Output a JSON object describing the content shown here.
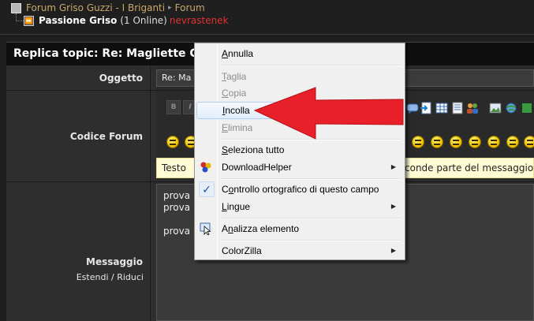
{
  "breadcrumb": {
    "forum_root": "Forum Griso Guzzi - I Briganti",
    "separator": "▸",
    "forum_link": "Forum",
    "forum_name": "Passione Griso",
    "online_count": "(1 Online)",
    "online_user": "nevrastenek"
  },
  "topic": {
    "header": "Replica topic: Re: Magliette G"
  },
  "form": {
    "subject_label": "Oggetto",
    "subject_value": "Re: Ma",
    "code_label": "Codice Forum",
    "toolbar_bold": "B",
    "toolbar_italic": "I",
    "help_text_left": "Testo",
    "help_text_right": "conde parte del messaggio a",
    "message_label": "Messaggio",
    "expand_label": "Estendi",
    "expand_sep": "/",
    "reduce_label": "Riduci",
    "message_lines": [
      "prova",
      "prova",
      "",
      "prova p"
    ]
  },
  "context_menu": {
    "items": [
      {
        "label": "Annulla",
        "accel": "A",
        "rest": "nnulla",
        "disabled": false
      },
      {
        "label": "Taglia",
        "accel": "T",
        "rest": "aglia",
        "disabled": true
      },
      {
        "label": "Copia",
        "accel": "C",
        "rest": "opia",
        "disabled": true
      },
      {
        "label": "Incolla",
        "accel": "I",
        "rest": "ncolla",
        "disabled": false
      },
      {
        "label": "Elimina",
        "accel": "E",
        "rest": "limina",
        "disabled": true
      },
      {
        "label": "Seleziona tutto",
        "accel": "S",
        "rest": "eleziona tutto",
        "disabled": false
      },
      {
        "label": "DownloadHelper",
        "disabled": false
      },
      {
        "label": "Controllo ortografico di questo campo",
        "accel": "o",
        "pre": "C",
        "rest": "ntrollo ortografico di questo campo",
        "disabled": false
      },
      {
        "label": "Lingue",
        "accel": "L",
        "rest": "ingue",
        "disabled": false
      },
      {
        "label": "Analizza elemento",
        "accel": "n",
        "pre": "A",
        "rest": "alizza elemento",
        "disabled": false
      },
      {
        "label": "ColorZilla",
        "disabled": false
      }
    ],
    "submenu_arrow": "▶",
    "check_mark": "✓",
    "icons": [
      "downloadhelper-icon",
      "check-icon",
      "inspect-element-icon"
    ]
  },
  "colors": {
    "arrow": "#e8202a",
    "online_user": "#e23030",
    "link": "#c9a86a",
    "help_bg": "#fffbd4"
  }
}
